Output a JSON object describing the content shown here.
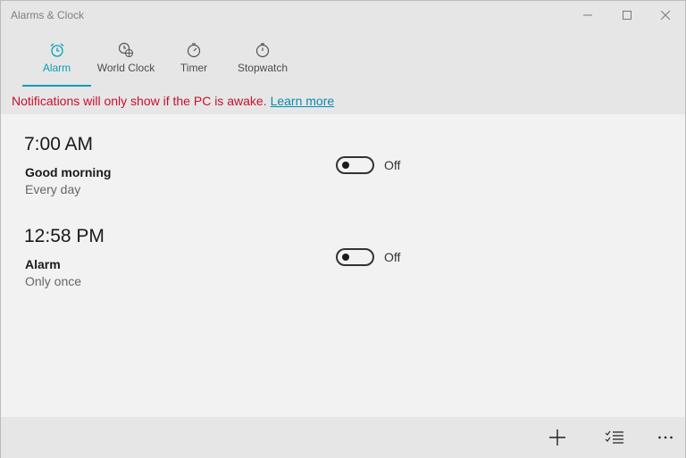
{
  "window": {
    "title": "Alarms & Clock",
    "controls": [
      "minimize-icon",
      "maximize-icon",
      "close-icon"
    ]
  },
  "tabs": [
    {
      "label": "Alarm",
      "icon": "alarm-clock-icon",
      "active": true
    },
    {
      "label": "World Clock",
      "icon": "world-clock-icon",
      "active": false
    },
    {
      "label": "Timer",
      "icon": "timer-icon",
      "active": false
    },
    {
      "label": "Stopwatch",
      "icon": "stopwatch-icon",
      "active": false
    }
  ],
  "notice": {
    "text": "Notifications will only show if the PC is awake.",
    "link": "Learn more"
  },
  "alarms": [
    {
      "time": "7:00 AM",
      "name": "Good morning",
      "repeat": "Every day",
      "enabled": false,
      "state_label": "Off"
    },
    {
      "time": "12:58 PM",
      "name": "Alarm",
      "repeat": "Only once",
      "enabled": false,
      "state_label": "Off"
    }
  ],
  "commandbar": {
    "icons": [
      "add-icon",
      "select-list-icon",
      "more-icon"
    ]
  },
  "colors": {
    "accent": "#0aa0b9",
    "notice_text": "#c8102e",
    "link": "#0a8bb0",
    "chrome": "#e6e6e6",
    "content": "#f2f2f2"
  }
}
